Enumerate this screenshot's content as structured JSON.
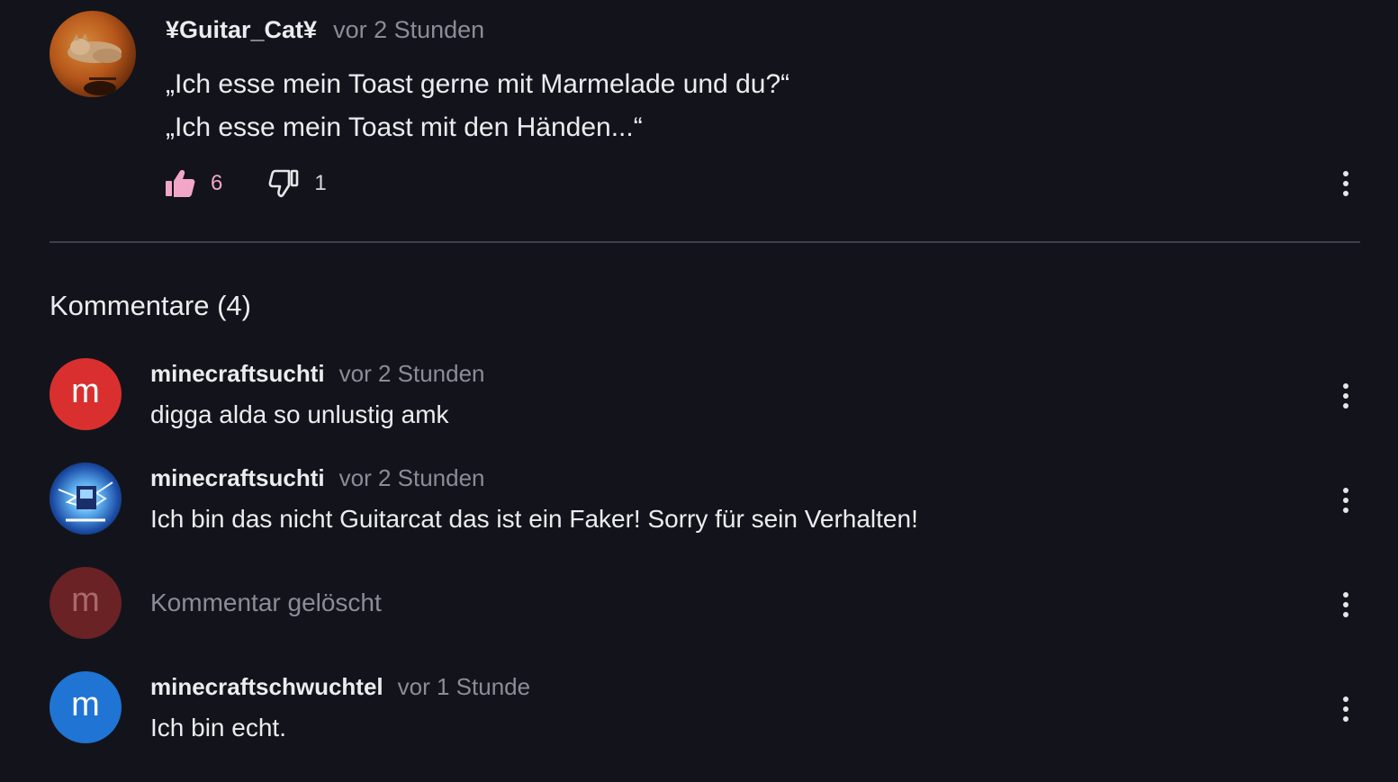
{
  "post": {
    "author": "¥Guitar_Cat¥",
    "time": "vor 2 Stunden",
    "lines": [
      "„Ich esse mein Toast gerne mit Marmelade und du?“",
      "„Ich esse mein Toast mit den Händen...“"
    ],
    "likes": "6",
    "dislikes": "1",
    "like_icon": "thumbs-up-icon",
    "dislike_icon": "thumbs-down-icon",
    "more_icon": "more-vertical-icon"
  },
  "comments_section": {
    "title": "Kommentare (4)",
    "comments": [
      {
        "avatar_letter": "m",
        "avatar_color": "#d9302f",
        "author": "minecraftsuchti",
        "time": "vor 2 Stunden",
        "text": "digga alda so unlustig amk"
      },
      {
        "avatar_letter": "",
        "avatar_color": "#1c3f8a",
        "author": "minecraftsuchti",
        "time": "vor 2 Stunden",
        "text": "Ich bin das nicht Guitarcat das ist ein Faker! Sorry für sein Verhalten!"
      },
      {
        "avatar_letter": "m",
        "avatar_color": "#6a2225",
        "deleted_text": "Kommentar gelöscht"
      },
      {
        "avatar_letter": "m",
        "avatar_color": "#1f74d4",
        "author": "minecraftschwuchtel",
        "time": "vor 1 Stunde",
        "text": "Ich bin echt."
      }
    ]
  }
}
